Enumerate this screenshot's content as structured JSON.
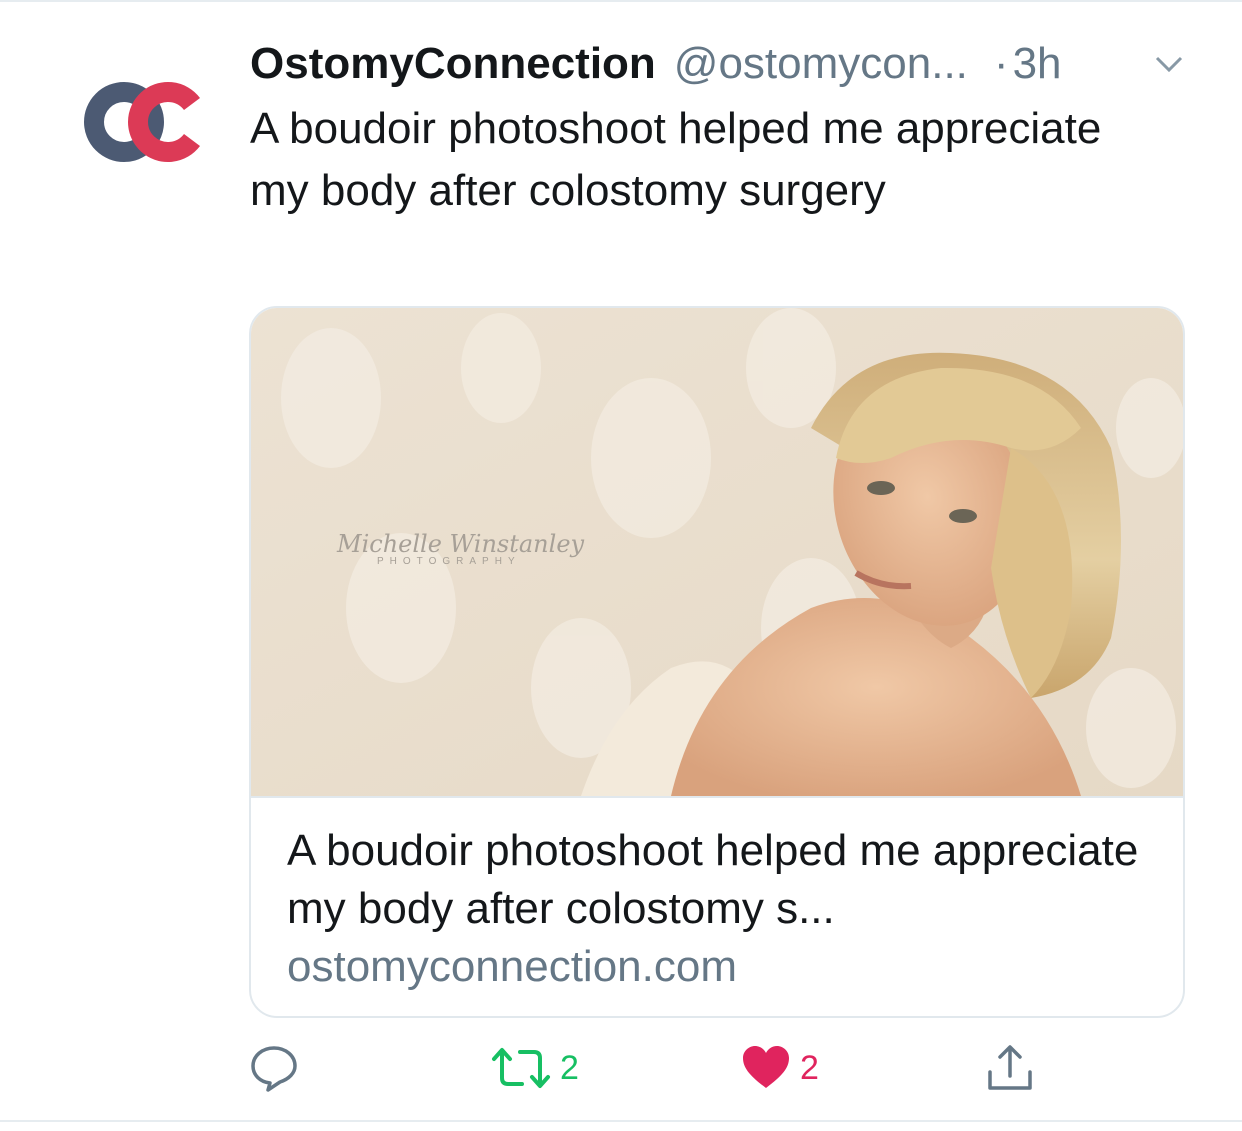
{
  "colors": {
    "text": "#14171a",
    "secondary": "#657786",
    "border": "#e1e8ed",
    "retweet_green": "#17bf63",
    "like_red": "#e0245e",
    "logo_slate": "#4c5a73",
    "logo_red": "#dc3a56"
  },
  "tweet": {
    "display_name": "OstomyConnection",
    "handle": "@ostomycon...",
    "separator": "·",
    "time": "3h",
    "text": "A boudoir photoshoot helped me appreciate my body after colostomy surgery",
    "avatar_icon": "ostomyconnection-logo-icon",
    "menu_icon": "chevron-down-icon"
  },
  "card": {
    "image_alt": "Woman with blonde bob haircut posing against damask wallpaper",
    "watermark_name": "Michelle Winstanley",
    "watermark_sub": "PHOTOGRAPHY",
    "title": "A boudoir photoshoot helped me appreciate my body after colostomy s...",
    "domain": "ostomyconnection.com"
  },
  "actions": {
    "reply": {
      "icon": "reply-icon",
      "count": ""
    },
    "retweet": {
      "icon": "retweet-icon",
      "count": "2"
    },
    "like": {
      "icon": "heart-icon",
      "count": "2"
    },
    "share": {
      "icon": "share-icon",
      "count": ""
    }
  }
}
